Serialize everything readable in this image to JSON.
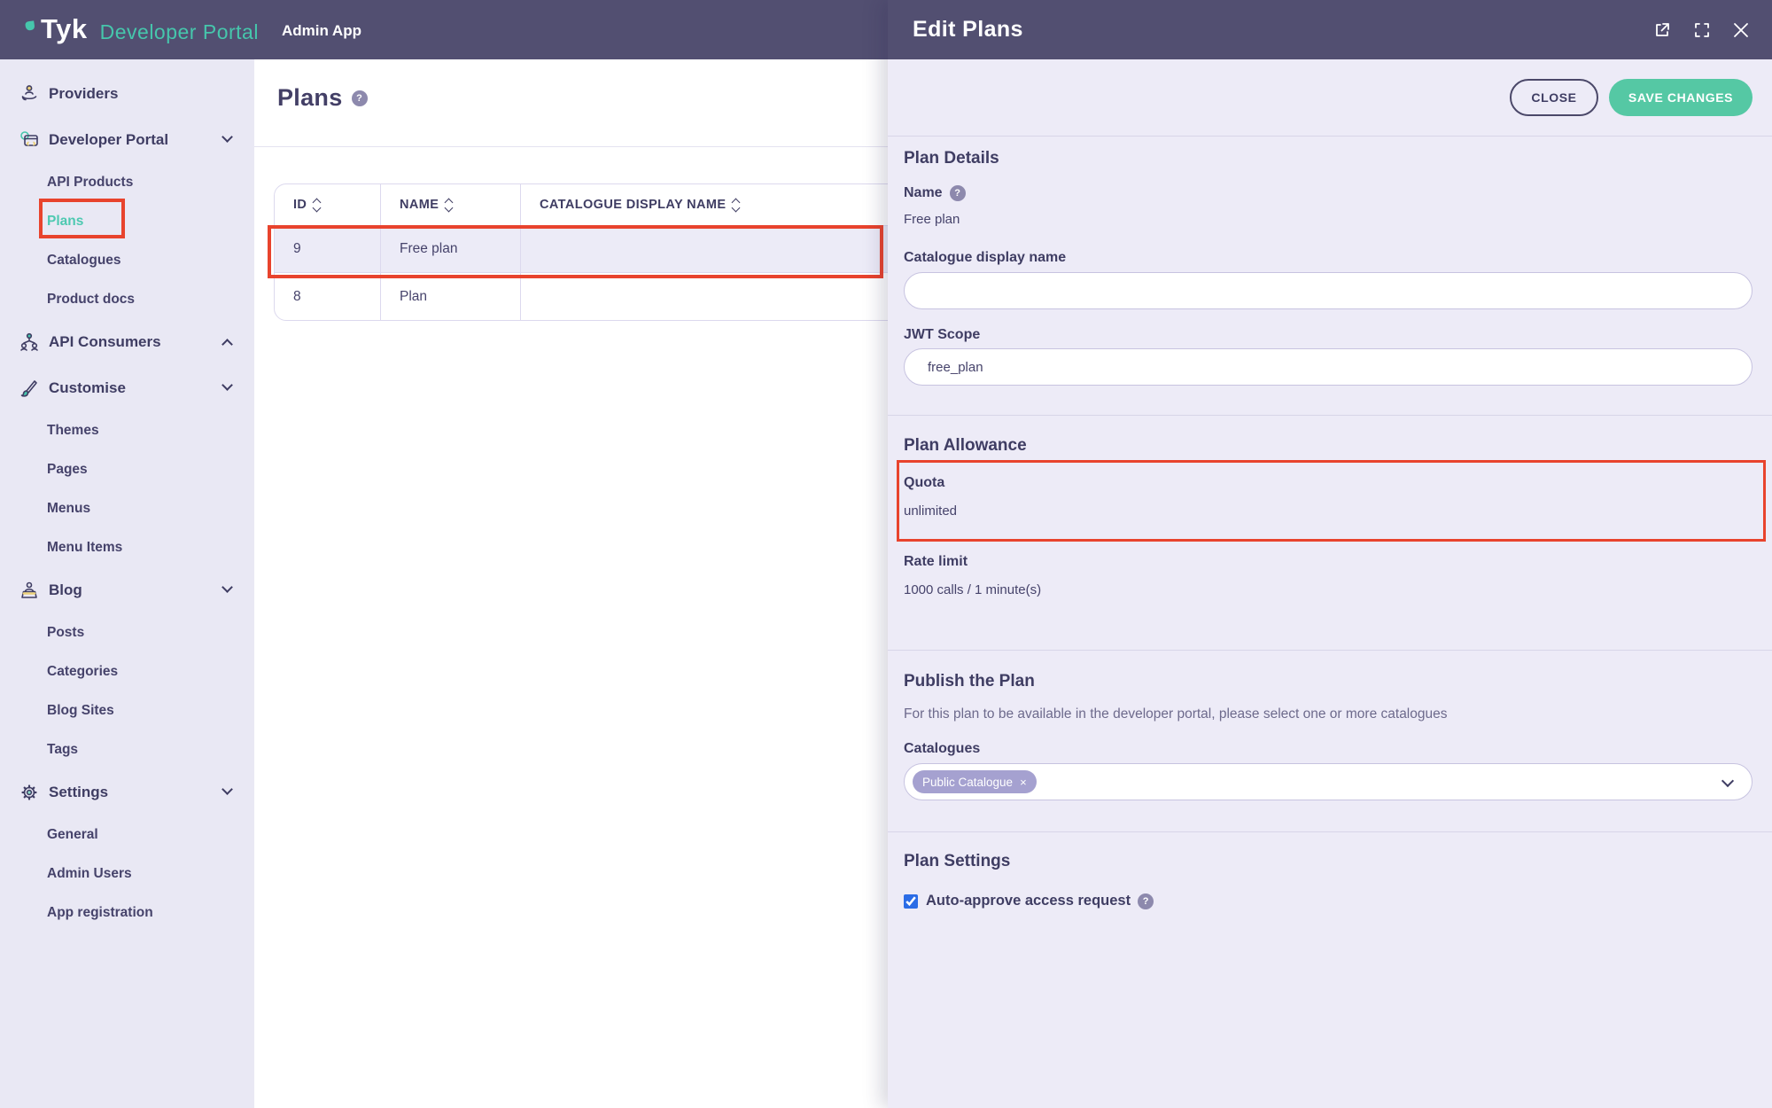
{
  "navbar": {
    "logo_text": "Tyk",
    "logo_subtext": "Developer Portal",
    "app_label": "Admin App"
  },
  "sidebar": {
    "items": [
      {
        "label": "Providers"
      },
      {
        "label": "Developer Portal"
      },
      {
        "label": "API Products"
      },
      {
        "label": "Plans"
      },
      {
        "label": "Catalogues"
      },
      {
        "label": "Product docs"
      },
      {
        "label": "API Consumers"
      },
      {
        "label": "Customise"
      },
      {
        "label": "Themes"
      },
      {
        "label": "Pages"
      },
      {
        "label": "Menus"
      },
      {
        "label": "Menu Items"
      },
      {
        "label": "Blog"
      },
      {
        "label": "Posts"
      },
      {
        "label": "Categories"
      },
      {
        "label": "Blog Sites"
      },
      {
        "label": "Tags"
      },
      {
        "label": "Settings"
      },
      {
        "label": "General"
      },
      {
        "label": "Admin Users"
      },
      {
        "label": "App registration"
      }
    ]
  },
  "main": {
    "title": "Plans",
    "help_glyph": "?",
    "table": {
      "columns": [
        "ID",
        "NAME",
        "CATALOGUE DISPLAY NAME"
      ],
      "rows": [
        {
          "id": "9",
          "name": "Free plan",
          "catalogue_display_name": ""
        },
        {
          "id": "8",
          "name": "Plan",
          "catalogue_display_name": ""
        }
      ]
    }
  },
  "drawer": {
    "title": "Edit Plans",
    "close_label": "CLOSE",
    "save_label": "SAVE CHANGES",
    "plan_details": {
      "heading": "Plan Details",
      "name_label": "Name",
      "name_help_glyph": "?",
      "name_value": "Free plan",
      "catalogue_display_label": "Catalogue display name",
      "catalogue_display_value": "",
      "jwt_label": "JWT Scope",
      "jwt_value": "free_plan"
    },
    "plan_allowance": {
      "heading": "Plan Allowance",
      "quota_label": "Quota",
      "quota_value": "unlimited",
      "rate_label": "Rate limit",
      "rate_value": "1000 calls / 1 minute(s)"
    },
    "publish": {
      "heading": "Publish the Plan",
      "description": "For this plan to be available in the developer portal, please select one or more catalogues",
      "catalogues_label": "Catalogues",
      "selected_catalogue": "Public Catalogue",
      "chip_remove_glyph": "×"
    },
    "settings": {
      "heading": "Plan Settings",
      "auto_approve_label": "Auto-approve access request",
      "auto_approve_help_glyph": "?",
      "auto_approve_checked": "checked"
    }
  },
  "colors": {
    "navbar_bg": "#524f71",
    "sidebar_bg": "#e9e8f4",
    "drawer_bg": "#edebf7",
    "brand_teal": "#46c6ac",
    "save_button": "#55c8a4",
    "annotation_red": "#e8432d",
    "text_navy": "#3f3d63",
    "chip_lavender": "#a5a1d0",
    "checkbox_blue": "#2b6ce6"
  }
}
